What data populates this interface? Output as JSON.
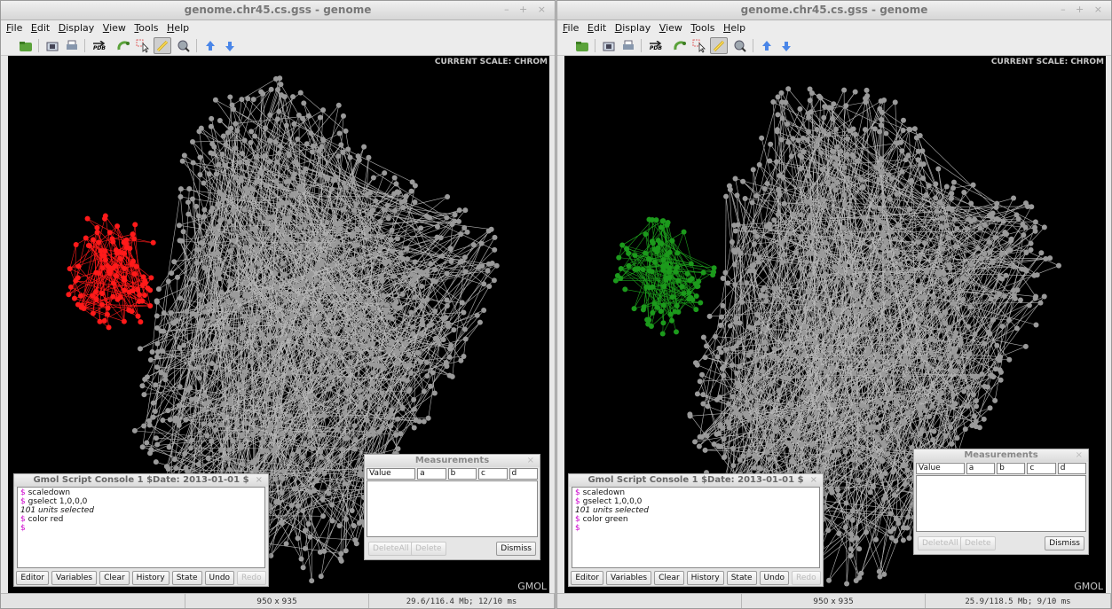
{
  "windows": [
    {
      "title": "genome.chr45.cs.gss - genome",
      "window_controls": "– + ×",
      "menu": [
        "File",
        "Edit",
        "Display",
        "View",
        "Tools",
        "Help"
      ],
      "scale_label": "CURRENT SCALE: CHROM",
      "logo": "GMOL",
      "highlight_color": "#ff1a1a",
      "console": {
        "title": "Gmol Script Console 1  $Date: 2013-01-01 $",
        "close": "×",
        "lines": [
          {
            "prompt": "$",
            "text": "scaledown"
          },
          {
            "prompt": "$",
            "text": "gselect 1,0,0,0"
          },
          {
            "prompt": "",
            "text": "101 units selected"
          },
          {
            "prompt": "$",
            "text": "color red"
          },
          {
            "prompt": "$",
            "text": ""
          }
        ],
        "buttons": [
          "Editor",
          "Variables",
          "Clear",
          "History",
          "State",
          "Undo",
          "Redo"
        ]
      },
      "measurements": {
        "title": "Measurements",
        "close": "×",
        "columns": [
          "Value",
          "a",
          "b",
          "c",
          "d"
        ],
        "delete_all": "DeleteAll",
        "delete": "Delete",
        "dismiss": "Dismiss"
      },
      "status": {
        "left": "",
        "dims": "950 x 935",
        "memory": "29.6/116.4 Mb;  12/10 ms"
      }
    },
    {
      "title": "genome.chr45.cs.gss - genome",
      "window_controls": "– + ×",
      "menu": [
        "File",
        "Edit",
        "Display",
        "View",
        "Tools",
        "Help"
      ],
      "scale_label": "CURRENT SCALE: CHROM",
      "logo": "GMOL",
      "highlight_color": "#1c9a1c",
      "console": {
        "title": "Gmol Script Console 1  $Date: 2013-01-01 $",
        "close": "×",
        "lines": [
          {
            "prompt": "$",
            "text": "scaledown"
          },
          {
            "prompt": "$",
            "text": "gselect 1,0,0,0"
          },
          {
            "prompt": "",
            "text": "101 units selected"
          },
          {
            "prompt": "$",
            "text": "color green"
          },
          {
            "prompt": "$",
            "text": ""
          }
        ],
        "buttons": [
          "Editor",
          "Variables",
          "Clear",
          "History",
          "State",
          "Undo",
          "Redo"
        ]
      },
      "measurements": {
        "title": "Measurements",
        "close": "×",
        "columns": [
          "Value",
          "a",
          "b",
          "c",
          "d"
        ],
        "delete_all": "DeleteAll",
        "delete": "Delete",
        "dismiss": "Dismiss"
      },
      "status": {
        "left": "",
        "dims": "950 x 935",
        "memory": "25.9/118.5 Mb;   9/10 ms"
      }
    }
  ],
  "toolbar_icons": [
    "open-icon",
    "screenshot-icon",
    "print-icon",
    "export-pdb-icon",
    "rotate-icon",
    "select-icon",
    "measure-icon",
    "spin-icon",
    "zoom-in-icon",
    "zoom-out-icon"
  ],
  "export_pdb_label": "PDB",
  "atom_color": "#9a9a9a",
  "bond_color": "#b5b5b5"
}
